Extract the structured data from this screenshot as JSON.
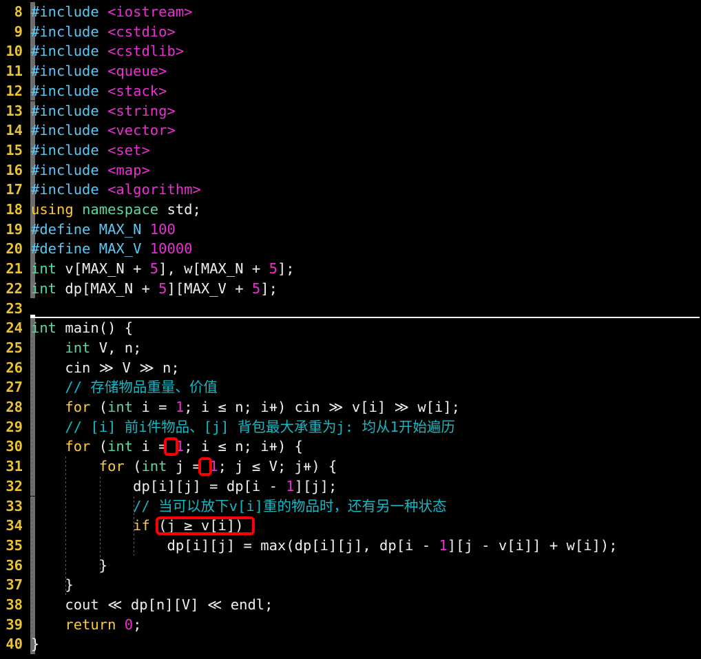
{
  "editor": {
    "theme": "dark-terminal",
    "language": "cpp",
    "first_line": 8,
    "last_line": 40,
    "colors": {
      "background": "#000000",
      "line_number": "#e8c33a",
      "keyword": "#ffc83d",
      "preprocessor": "#5bc8f5",
      "header_name": "#ec2fd4",
      "type": "#5fd7a0",
      "number": "#ec2fd4",
      "comment": "#13b9c4",
      "plain_text": "#f0f0f0",
      "change_bar": "#6e6e6e",
      "fold_separator": "#ffffff",
      "annotation": "#ff0000",
      "indent_guide": "#5a5a5a"
    }
  },
  "lines": [
    {
      "no": "8",
      "text": "#include <iostream>"
    },
    {
      "no": "9",
      "text": "#include <cstdio>"
    },
    {
      "no": "10",
      "text": "#include <cstdlib>"
    },
    {
      "no": "11",
      "text": "#include <queue>"
    },
    {
      "no": "12",
      "text": "#include <stack>"
    },
    {
      "no": "13",
      "text": "#include <string>"
    },
    {
      "no": "14",
      "text": "#include <vector>"
    },
    {
      "no": "15",
      "text": "#include <set>"
    },
    {
      "no": "16",
      "text": "#include <map>"
    },
    {
      "no": "17",
      "text": "#include <algorithm>"
    },
    {
      "no": "18",
      "text": "using namespace std;"
    },
    {
      "no": "19",
      "text": "#define MAX_N 100"
    },
    {
      "no": "20",
      "text": "#define MAX_V 10000"
    },
    {
      "no": "21",
      "text": "int v[MAX_N + 5], w[MAX_N + 5];"
    },
    {
      "no": "22",
      "text": "int dp[MAX_N + 5][MAX_V + 5];"
    },
    {
      "no": "23",
      "text": ""
    },
    {
      "no": "24",
      "text": "int main() {"
    },
    {
      "no": "25",
      "text": "    int V, n;"
    },
    {
      "no": "26",
      "text": "    cin >> V >> n;"
    },
    {
      "no": "27",
      "text": "    // 存储物品重量、价值"
    },
    {
      "no": "28",
      "text": "    for (int i = 1; i <= n; i++) cin >> v[i] >> w[i];"
    },
    {
      "no": "29",
      "text": "    // [i] 前i件物品、[j] 背包最大承重为j: 均从1开始遍历"
    },
    {
      "no": "30",
      "text": "    for (int i = 1; i <= n; i++) {"
    },
    {
      "no": "31",
      "text": "        for (int j = 1; j <= V; j++) {"
    },
    {
      "no": "32",
      "text": "            dp[i][j] = dp[i - 1][j];"
    },
    {
      "no": "33",
      "text": "            // 当可以放下v[i]重的物品时，还有另一种状态"
    },
    {
      "no": "34",
      "text": "            if (j >= v[i])"
    },
    {
      "no": "35",
      "text": "                dp[i][j] = max(dp[i][j], dp[i - 1][j - v[i]] + w[i]);"
    },
    {
      "no": "36",
      "text": "        }"
    },
    {
      "no": "37",
      "text": "    }"
    },
    {
      "no": "38",
      "text": "    cout << dp[n][V] << endl;"
    },
    {
      "no": "39",
      "text": "    return 0;"
    },
    {
      "no": "40",
      "text": "}"
    }
  ],
  "tokens": {
    "l8": [
      [
        "pp",
        "#include"
      ],
      [
        "id",
        " "
      ],
      [
        "hdr",
        "<iostream>"
      ]
    ],
    "l9": [
      [
        "pp",
        "#include"
      ],
      [
        "id",
        " "
      ],
      [
        "hdr",
        "<cstdio>"
      ]
    ],
    "l10": [
      [
        "pp",
        "#include"
      ],
      [
        "id",
        " "
      ],
      [
        "hdr",
        "<cstdlib>"
      ]
    ],
    "l11": [
      [
        "pp",
        "#include"
      ],
      [
        "id",
        " "
      ],
      [
        "hdr",
        "<queue>"
      ]
    ],
    "l12": [
      [
        "pp",
        "#include"
      ],
      [
        "id",
        " "
      ],
      [
        "hdr",
        "<stack>"
      ]
    ],
    "l13": [
      [
        "pp",
        "#include"
      ],
      [
        "id",
        " "
      ],
      [
        "hdr",
        "<string>"
      ]
    ],
    "l14": [
      [
        "pp",
        "#include"
      ],
      [
        "id",
        " "
      ],
      [
        "hdr",
        "<vector>"
      ]
    ],
    "l15": [
      [
        "pp",
        "#include"
      ],
      [
        "id",
        " "
      ],
      [
        "hdr",
        "<set>"
      ]
    ],
    "l16": [
      [
        "pp",
        "#include"
      ],
      [
        "id",
        " "
      ],
      [
        "hdr",
        "<map>"
      ]
    ],
    "l17": [
      [
        "pp",
        "#include"
      ],
      [
        "id",
        " "
      ],
      [
        "hdr",
        "<algorithm>"
      ]
    ],
    "l18": [
      [
        "kw",
        "using"
      ],
      [
        "id",
        " "
      ],
      [
        "type",
        "namespace"
      ],
      [
        "id",
        " std;"
      ]
    ],
    "l19": [
      [
        "pp",
        "#define MAX_N"
      ],
      [
        "id",
        " "
      ],
      [
        "num",
        "100"
      ]
    ],
    "l20": [
      [
        "pp",
        "#define MAX_V"
      ],
      [
        "id",
        " "
      ],
      [
        "num",
        "10000"
      ]
    ],
    "l21": [
      [
        "type",
        "int"
      ],
      [
        "id",
        " v[MAX_N + "
      ],
      [
        "num",
        "5"
      ],
      [
        "id",
        "], w[MAX_N + "
      ],
      [
        "num",
        "5"
      ],
      [
        "id",
        "];"
      ]
    ],
    "l22": [
      [
        "type",
        "int"
      ],
      [
        "id",
        " dp[MAX_N + "
      ],
      [
        "num",
        "5"
      ],
      [
        "id",
        "][MAX_V + "
      ],
      [
        "num",
        "5"
      ],
      [
        "id",
        "];"
      ]
    ],
    "l23": [
      [
        "id",
        ""
      ]
    ],
    "l24": [
      [
        "type",
        "int"
      ],
      [
        "id",
        " main() {"
      ]
    ],
    "l25": [
      [
        "id",
        "    "
      ],
      [
        "type",
        "int"
      ],
      [
        "id",
        " V, n;"
      ]
    ],
    "l26": [
      [
        "id",
        "    cin ≫ V ≫ n;"
      ]
    ],
    "l27": [
      [
        "id",
        "    "
      ],
      [
        "cmt",
        "// 存储物品重量、价值"
      ]
    ],
    "l28": [
      [
        "id",
        "    "
      ],
      [
        "kw",
        "for"
      ],
      [
        "id",
        " ("
      ],
      [
        "type",
        "int"
      ],
      [
        "id",
        " i = "
      ],
      [
        "num",
        "1"
      ],
      [
        "id",
        "; i ≤ n; i⧺) cin ≫ v[i] ≫ w[i];"
      ]
    ],
    "l29": [
      [
        "id",
        "    "
      ],
      [
        "cmt",
        "// [i] 前i件物品、[j] 背包最大承重为j: 均从1开始遍历"
      ]
    ],
    "l30": [
      [
        "id",
        "    "
      ],
      [
        "kw",
        "for"
      ],
      [
        "id",
        " ("
      ],
      [
        "type",
        "int"
      ],
      [
        "id",
        " i = "
      ],
      [
        "num",
        "1"
      ],
      [
        "id",
        "; i ≤ n; i⧺) {"
      ]
    ],
    "l31": [
      [
        "id",
        "        "
      ],
      [
        "kw",
        "for"
      ],
      [
        "id",
        " ("
      ],
      [
        "type",
        "int"
      ],
      [
        "id",
        " j = "
      ],
      [
        "num",
        "1"
      ],
      [
        "id",
        "; j ≤ V; j⧺) {"
      ]
    ],
    "l32": [
      [
        "id",
        "            dp[i][j] = dp[i - "
      ],
      [
        "num",
        "1"
      ],
      [
        "id",
        "][j];"
      ]
    ],
    "l33": [
      [
        "id",
        "            "
      ],
      [
        "cmt",
        "// 当可以放下v[i]重的物品时，还有另一种状态"
      ]
    ],
    "l34": [
      [
        "id",
        "            "
      ],
      [
        "kw",
        "if"
      ],
      [
        "id",
        " (j ≥ v[i])"
      ]
    ],
    "l35": [
      [
        "id",
        "                dp[i][j] = max(dp[i][j], dp[i - "
      ],
      [
        "num",
        "1"
      ],
      [
        "id",
        "][j - v[i]] + w[i]);"
      ]
    ],
    "l36": [
      [
        "id",
        "        }"
      ]
    ],
    "l37": [
      [
        "id",
        "    }"
      ]
    ],
    "l38": [
      [
        "id",
        "    cout ≪ dp[n][V] ≪ endl;"
      ]
    ],
    "l39": [
      [
        "id",
        "    "
      ],
      [
        "kw",
        "return"
      ],
      [
        "id",
        " "
      ],
      [
        "num",
        "0"
      ],
      [
        "id",
        ";"
      ]
    ],
    "l40": [
      [
        "id",
        "}"
      ]
    ]
  },
  "annotations": [
    {
      "id": "box-for-i-init",
      "target": "1",
      "line": "30",
      "note": "loop start value i = 1"
    },
    {
      "id": "box-for-j-init",
      "target": "1",
      "line": "31",
      "note": "loop start value j = 1"
    },
    {
      "id": "box-capacity-if",
      "target": "(j >= v[i])",
      "line": "34",
      "note": "capacity check condition"
    }
  ],
  "fold_separator": {
    "after_line": "23",
    "before_line": "24"
  }
}
